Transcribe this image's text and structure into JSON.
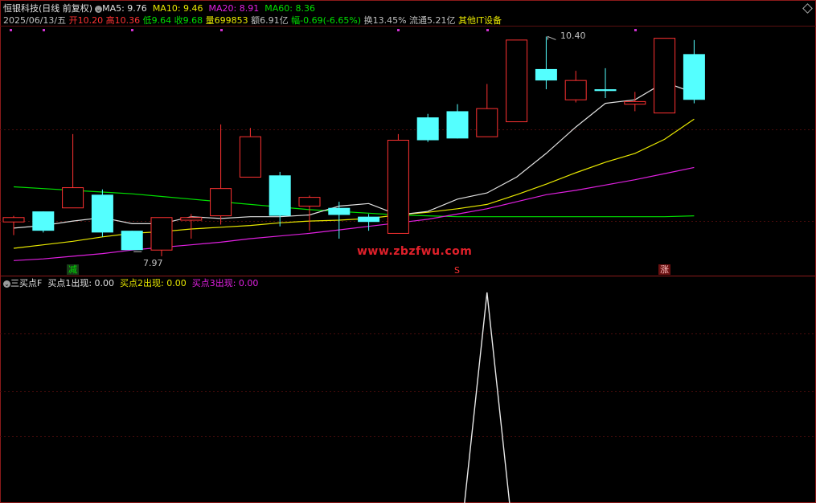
{
  "stock": {
    "name": "恒银科技(日线 前复权)",
    "ma5": "MA5: 9.76",
    "ma10": "MA10: 9.46",
    "ma20": "MA20: 8.91",
    "ma60": "MA60: 8.36",
    "date": "2025/06/13/五",
    "open": "开10.20",
    "high": "高10.36",
    "low": "低9.64",
    "close": "收9.68",
    "volume": "量699853",
    "amount": "额6.91亿",
    "change": "幅-0.69(-6.65%)",
    "turnover": "换13.45%",
    "float": "流通5.21亿",
    "industry": "其他IT设备"
  },
  "colors": {
    "up": "#ff3232",
    "down": "#54ffff",
    "ma5": "#e0e0e0",
    "ma10": "#e8e800",
    "ma20": "#e020e0",
    "ma60": "#00e000"
  },
  "annotations": {
    "high_label": "10.40",
    "low_label": "7.97",
    "tag_jian": "减",
    "tag_s": "S",
    "tag_zhang": "涨"
  },
  "watermark": "www.zbzfwu.com",
  "indicator": {
    "name": "三买点F",
    "buy1": "买点1出现: 0.00",
    "buy2": "买点2出现: 0.00",
    "buy3": "买点3出现: 0.00"
  },
  "chart_data": {
    "type": "candlestick",
    "candles": [
      {
        "o": 8.29,
        "c": 8.34,
        "h": 8.36,
        "l": 8.14
      },
      {
        "o": 8.41,
        "c": 8.19,
        "h": 8.41,
        "l": 8.17
      },
      {
        "o": 8.45,
        "c": 8.68,
        "h": 9.29,
        "l": 8.45
      },
      {
        "o": 8.6,
        "c": 8.17,
        "h": 8.66,
        "l": 8.12
      },
      {
        "o": 8.19,
        "c": 7.97,
        "h": 8.19,
        "l": 7.97
      },
      {
        "o": 7.97,
        "c": 8.34,
        "h": 8.34,
        "l": 7.9
      },
      {
        "o": 8.31,
        "c": 8.34,
        "h": 8.38,
        "l": 8.1
      },
      {
        "o": 8.36,
        "c": 8.67,
        "h": 9.4,
        "l": 8.26
      },
      {
        "o": 8.8,
        "c": 9.26,
        "h": 9.36,
        "l": 8.8
      },
      {
        "o": 8.82,
        "c": 8.36,
        "h": 8.86,
        "l": 8.24
      },
      {
        "o": 8.47,
        "c": 8.57,
        "h": 8.59,
        "l": 8.19
      },
      {
        "o": 8.45,
        "c": 8.37,
        "h": 8.52,
        "l": 8.1
      },
      {
        "o": 8.35,
        "c": 8.29,
        "h": 8.38,
        "l": 8.19
      },
      {
        "o": 8.16,
        "c": 9.22,
        "h": 9.29,
        "l": 8.16
      },
      {
        "o": 9.48,
        "c": 9.22,
        "h": 9.52,
        "l": 9.2
      },
      {
        "o": 9.55,
        "c": 9.24,
        "h": 9.63,
        "l": 9.24
      },
      {
        "o": 9.26,
        "c": 9.58,
        "h": 9.86,
        "l": 9.26
      },
      {
        "o": 9.43,
        "c": 10.36,
        "h": 10.36,
        "l": 9.43
      },
      {
        "o": 10.03,
        "c": 9.9,
        "h": 10.4,
        "l": 9.8
      },
      {
        "o": 9.68,
        "c": 9.9,
        "h": 10.01,
        "l": 9.65
      },
      {
        "o": 9.8,
        "c": 9.78,
        "h": 10.04,
        "l": 9.7
      },
      {
        "o": 9.63,
        "c": 9.66,
        "h": 9.77,
        "l": 9.55
      },
      {
        "o": 9.53,
        "c": 10.38,
        "h": 10.38,
        "l": 9.53
      },
      {
        "o": 10.2,
        "c": 9.68,
        "h": 10.36,
        "l": 9.64
      }
    ],
    "ma5": [
      8.22,
      8.25,
      8.3,
      8.34,
      8.27,
      8.27,
      8.35,
      8.33,
      8.35,
      8.35,
      8.37,
      8.47,
      8.5,
      8.37,
      8.41,
      8.55,
      8.62,
      8.8,
      9.07,
      9.37,
      9.64,
      9.68,
      9.88,
      9.76
    ],
    "ma10": [
      7.99,
      8.03,
      8.07,
      8.12,
      8.16,
      8.18,
      8.21,
      8.23,
      8.25,
      8.28,
      8.3,
      8.31,
      8.33,
      8.37,
      8.4,
      8.44,
      8.49,
      8.6,
      8.72,
      8.85,
      8.97,
      9.07,
      9.23,
      9.46
    ],
    "ma20": [
      7.85,
      7.87,
      7.9,
      7.93,
      7.97,
      8.0,
      8.03,
      8.06,
      8.1,
      8.13,
      8.16,
      8.2,
      8.24,
      8.28,
      8.32,
      8.38,
      8.44,
      8.52,
      8.6,
      8.65,
      8.71,
      8.77,
      8.84,
      8.91
    ],
    "ma60": [
      8.69,
      8.67,
      8.65,
      8.63,
      8.61,
      8.58,
      8.55,
      8.52,
      8.49,
      8.46,
      8.43,
      8.41,
      8.39,
      8.37,
      8.36,
      8.35,
      8.35,
      8.35,
      8.35,
      8.35,
      8.35,
      8.35,
      8.35,
      8.36
    ],
    "indicator_spike": {
      "index": 16,
      "value": 1
    }
  }
}
